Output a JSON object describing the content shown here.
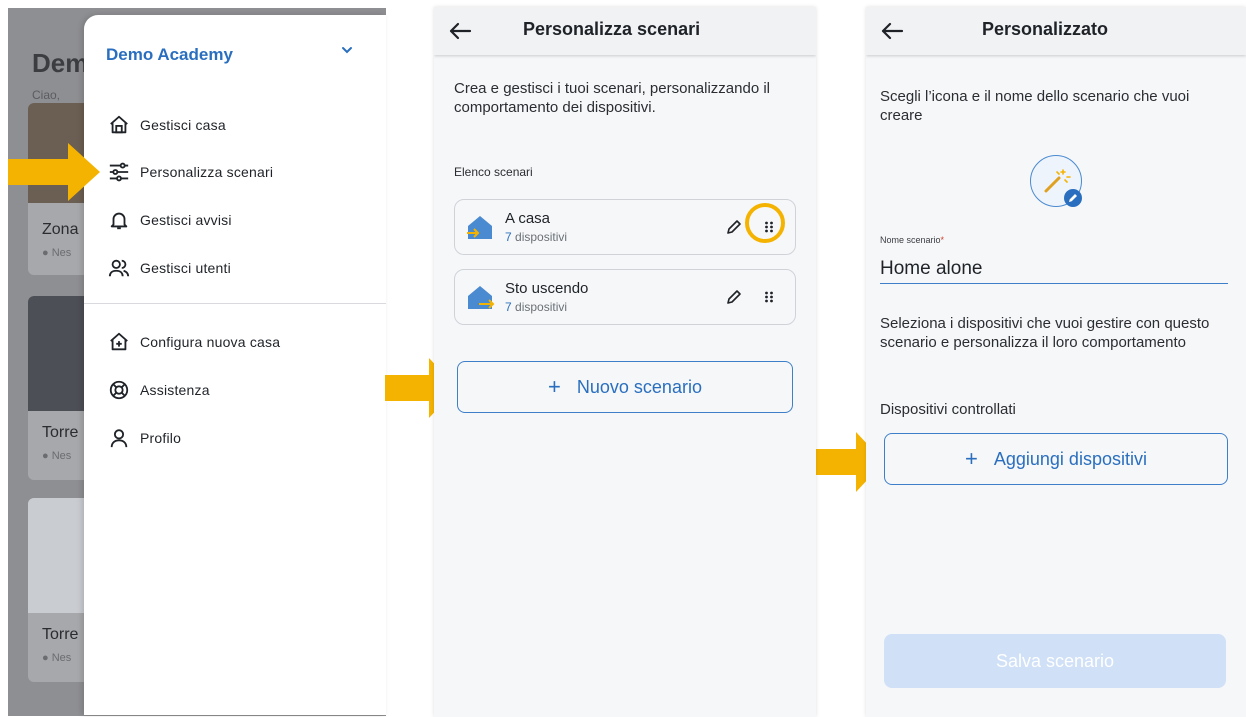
{
  "colors": {
    "accent": "#2a6fbf",
    "arrow": "#f5b301",
    "save_disabled": "#cfe0f7"
  },
  "background_app": {
    "title": "Dem",
    "greeting": "Ciao,",
    "cards": [
      {
        "label": "Zona",
        "status": "Nes"
      },
      {
        "label": "Torre",
        "status": "Nes"
      },
      {
        "label": "Torre",
        "status": "Nes"
      }
    ]
  },
  "drawer": {
    "home_name": "Demo Academy",
    "chevron_icon": "chevron-down-icon",
    "items": [
      {
        "label": "Gestisci casa",
        "icon": "home-icon"
      },
      {
        "label": "Personalizza scenari",
        "icon": "sliders-icon"
      },
      {
        "label": "Gestisci avvisi",
        "icon": "bell-icon"
      },
      {
        "label": "Gestisci utenti",
        "icon": "users-icon"
      }
    ],
    "secondary_items": [
      {
        "label": "Configura nuova casa",
        "icon": "home-plus-icon"
      },
      {
        "label": "Assistenza",
        "icon": "lifebuoy-icon"
      },
      {
        "label": "Profilo",
        "icon": "user-icon"
      }
    ]
  },
  "scenarios_screen": {
    "title": "Personalizza scenari",
    "back_icon": "arrow-left-icon",
    "intro": "Crea e gestisci i tuoi scenari, personalizzando il comportamento dei dispositivi.",
    "list_label": "Elenco scenari",
    "scenarios": [
      {
        "name": "A casa",
        "count": "7",
        "count_suffix": "dispositivi",
        "icon": "home-arrive-icon"
      },
      {
        "name": "Sto uscendo",
        "count": "7",
        "count_suffix": "dispositivi",
        "icon": "home-leave-icon"
      }
    ],
    "new_button": {
      "plus": "+",
      "label": "Nuovo scenario"
    }
  },
  "custom_screen": {
    "title": "Personalizzato",
    "back_icon": "arrow-left-icon",
    "intro": "Scegli l’icona e il nome dello scenario che vuoi creare",
    "scenario_icon": "magic-wand-icon",
    "name_label": "Nome scenario",
    "name_required": "*",
    "name_value": "Home alone",
    "devices_intro": "Seleziona i dispositivi che vuoi gestire con questo scenario e personalizza il loro comportamento",
    "devices_label": "Dispositivi controllati",
    "add_button": {
      "plus": "+",
      "label": "Aggiungi dispositivi"
    },
    "save_button": "Salva scenario"
  }
}
